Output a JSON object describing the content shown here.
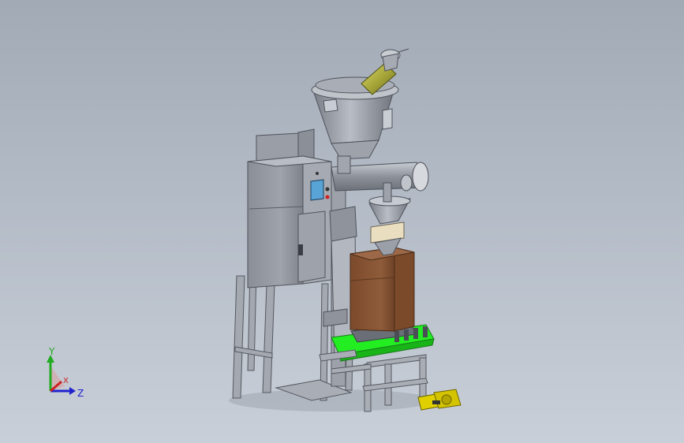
{
  "axis_triad": {
    "y_label": "Y",
    "x_label": "X",
    "z_label": "Z",
    "y_color": "#22aa22",
    "x_color": "#cc2222",
    "z_color": "#2222cc"
  },
  "colors": {
    "background_top": "#a2aab6",
    "background_bottom": "#c9cfd8",
    "frame_grey": "#9a9ea8",
    "cabinet_grey": "#8f939c",
    "bag_brown": "#8a5a3a",
    "platform_green": "#22ee22",
    "feed_tube_yellow": "#b8b83a",
    "motor_yellow": "#d4c400"
  }
}
